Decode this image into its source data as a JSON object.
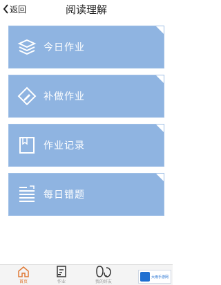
{
  "header": {
    "back_label": "返回",
    "title": "阅读理解"
  },
  "cards": [
    {
      "label": "今日作业",
      "icon": "layers-icon"
    },
    {
      "label": "补做作业",
      "icon": "pen-diamond-icon"
    },
    {
      "label": "作业记录",
      "icon": "book-icon"
    },
    {
      "label": "每日错题",
      "icon": "list-doc-icon"
    }
  ],
  "bottom_tabs": [
    {
      "label": "首页",
      "icon": "home-icon",
      "active": true
    },
    {
      "label": "作业",
      "icon": "homework-icon",
      "active": false
    },
    {
      "label": "我的好友",
      "icon": "friends-icon",
      "active": false
    }
  ],
  "watermark": {
    "text": "大雨手游网"
  },
  "colors": {
    "card": "#8fb4e1",
    "active_tab": "#e07a36"
  }
}
